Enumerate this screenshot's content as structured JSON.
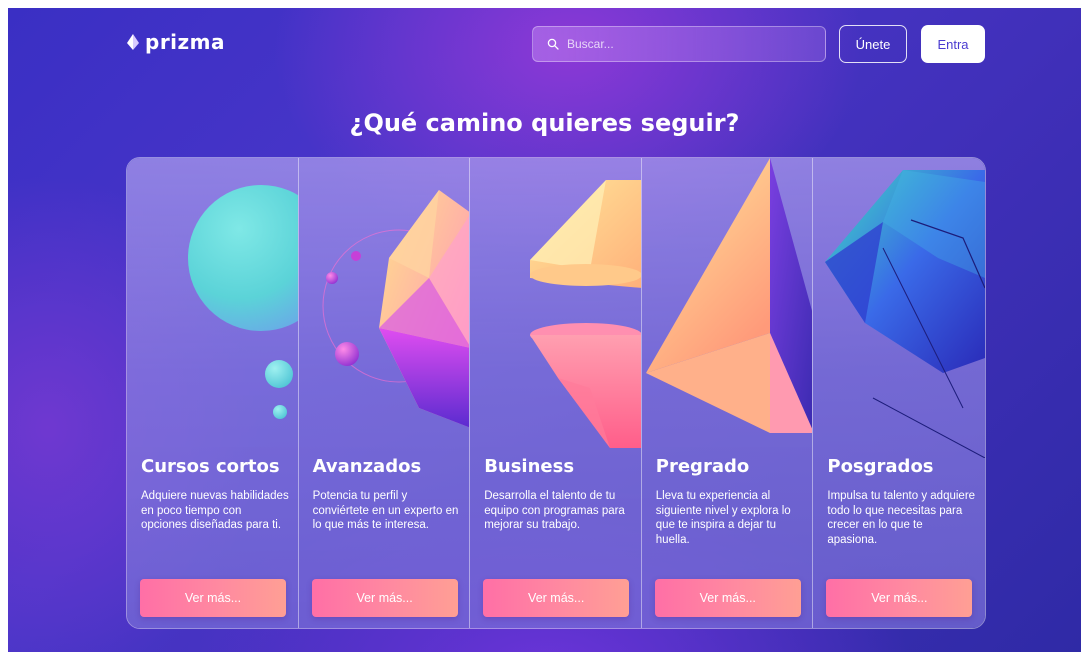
{
  "header": {
    "brand": "prizma",
    "search_placeholder": "Buscar...",
    "join_label": "Únete",
    "login_label": "Entra"
  },
  "main": {
    "heading": "¿Qué camino quieres seguir?"
  },
  "cards": [
    {
      "title": "Cursos cortos",
      "description": "Adquiere nuevas habilidades en poco tiempo con opciones diseñadas para ti.",
      "button": "Ver más..."
    },
    {
      "title": "Avanzados",
      "description": "Potencia tu perfil y conviértete en un experto en lo que más te interesa.",
      "button": "Ver más..."
    },
    {
      "title": "Business",
      "description": "Desarrolla el talento de tu equipo con programas para mejorar su trabajo.",
      "button": "Ver más..."
    },
    {
      "title": "Pregrado",
      "description": "Lleva tu experiencia al siguiente nivel y explora lo que te inspira a dejar tu huella.",
      "button": "Ver más..."
    },
    {
      "title": "Posgrados",
      "description": "Impulsa tu talento y adquiere todo lo que necesitas para crecer en lo que te apasiona.",
      "button": "Ver más..."
    }
  ],
  "colors": {
    "background": "#3a2fc4",
    "button_gradient_start": "#ff6fa6",
    "button_gradient_end": "#ff9f94",
    "login_text": "#4a3bd0"
  }
}
